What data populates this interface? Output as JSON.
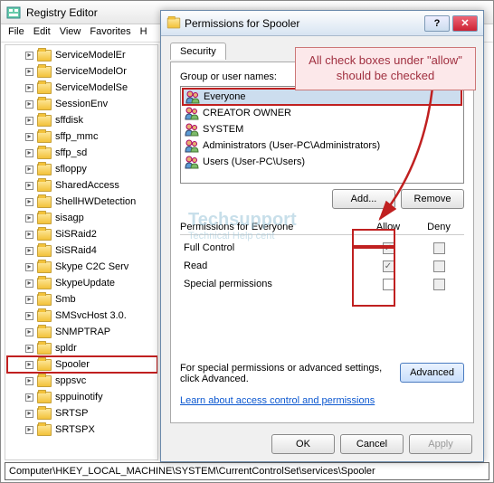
{
  "regedit": {
    "title": "Registry Editor",
    "menu": [
      "File",
      "Edit",
      "View",
      "Favorites",
      "H"
    ],
    "tree": [
      "ServiceModelEr",
      "ServiceModelOr",
      "ServiceModelSe",
      "SessionEnv",
      "sffdisk",
      "sffp_mmc",
      "sffp_sd",
      "sfloppy",
      "SharedAccess",
      "ShellHWDetection",
      "sisagp",
      "SiSRaid2",
      "SiSRaid4",
      "Skype C2C Serv",
      "SkypeUpdate",
      "Smb",
      "SMSvcHost 3.0.",
      "SNMPTRAP",
      "spldr",
      "Spooler",
      "sppsvc",
      "sppuinotify",
      "SRTSP",
      "SRTSPX"
    ],
    "selected_index": 19,
    "status_path": "Computer\\HKEY_LOCAL_MACHINE\\SYSTEM\\CurrentControlSet\\services\\Spooler"
  },
  "perm": {
    "title": "Permissions for Spooler",
    "tab": "Security",
    "group_label": "Group or user names:",
    "groups": [
      {
        "name": "Everyone",
        "selected": true
      },
      {
        "name": "CREATOR OWNER"
      },
      {
        "name": "SYSTEM"
      },
      {
        "name": "Administrators (User-PC\\Administrators)"
      },
      {
        "name": "Users (User-PC\\Users)"
      }
    ],
    "add_label": "Add...",
    "remove_label": "Remove",
    "perms_for": "Permissions for Everyone",
    "allow_label": "Allow",
    "deny_label": "Deny",
    "perms": [
      {
        "name": "Full Control",
        "allow": true,
        "allow_grey": true
      },
      {
        "name": "Read",
        "allow": true,
        "allow_grey": true
      },
      {
        "name": "Special permissions",
        "allow": false,
        "allow_grey": false
      }
    ],
    "adv_text": "For special permissions or advanced settings, click Advanced.",
    "adv_btn": "Advanced",
    "link": "Learn about access control and permissions",
    "ok": "OK",
    "cancel": "Cancel",
    "apply": "Apply"
  },
  "annotation": {
    "text": "All check boxes under \"allow\" should be checked"
  },
  "watermark": {
    "line1": "Techsupport",
    "line2": "Technical Help cent"
  }
}
